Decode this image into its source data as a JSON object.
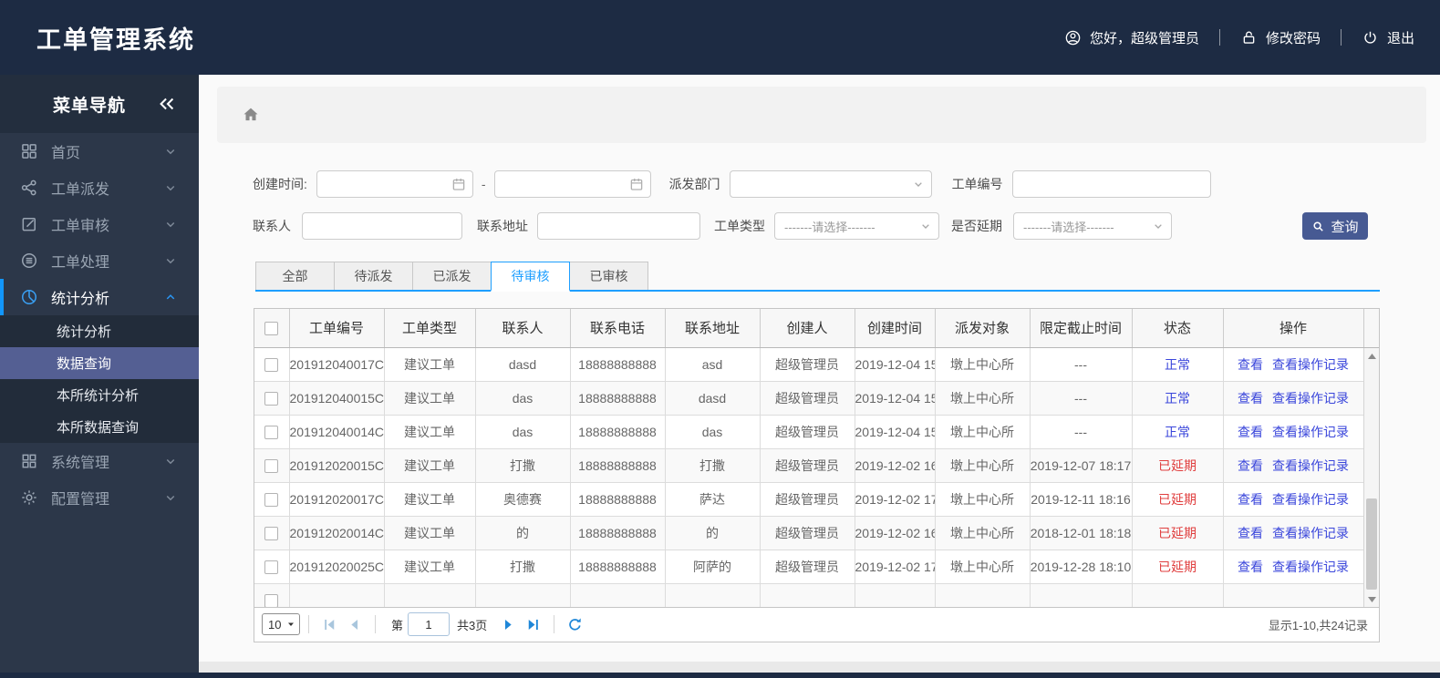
{
  "colors": {
    "header_bg": "#1d2b43",
    "sidebar_bg": "#2c3749",
    "sidebar_accent": "#1296fb",
    "submenu_selected": "#545f93",
    "tab_accent": "#1e9fff",
    "link_blue": "#3a46db",
    "status_normal_blue": "#3a46db",
    "status_overdue_red": "#e03e3e",
    "search_button": "#475a93"
  },
  "header": {
    "title": "工单管理系统",
    "greeting": "您好，超级管理员",
    "change_password": "修改密码",
    "logout": "退出"
  },
  "sidebar": {
    "title": "菜单导航",
    "items": [
      {
        "key": "home",
        "icon": "grid-icon",
        "label": "首页"
      },
      {
        "key": "dispatch",
        "icon": "share-icon",
        "label": "工单派发"
      },
      {
        "key": "review",
        "icon": "edit-icon",
        "label": "工单审核"
      },
      {
        "key": "process",
        "icon": "process-icon",
        "label": "工单处理"
      },
      {
        "key": "stats",
        "icon": "pie-icon",
        "label": "统计分析",
        "active": true,
        "children": [
          {
            "key": "stats-analysis",
            "label": "统计分析"
          },
          {
            "key": "data-query",
            "label": "数据查询",
            "selected": true
          },
          {
            "key": "branch-stats",
            "label": "本所统计分析"
          },
          {
            "key": "branch-data-query",
            "label": "本所数据查询"
          }
        ]
      },
      {
        "key": "system",
        "icon": "modules-icon",
        "label": "系统管理"
      },
      {
        "key": "config",
        "icon": "gear-icon",
        "label": "配置管理"
      }
    ]
  },
  "filters": {
    "created_time_label": "创建时间:",
    "date_separator": "-",
    "dispatch_dept_label": "派发部门",
    "order_no_label": "工单编号",
    "contact_label": "联系人",
    "address_label": "联系地址",
    "order_type_label": "工单类型",
    "delay_label": "是否延期",
    "select_placeholder": "-------请选择-------",
    "search_button": "查询"
  },
  "tabs": [
    {
      "key": "all",
      "label": "全部"
    },
    {
      "key": "pending-dispatch",
      "label": "待派发"
    },
    {
      "key": "dispatched",
      "label": "已派发"
    },
    {
      "key": "pending-review",
      "label": "待审核",
      "active": true
    },
    {
      "key": "reviewed",
      "label": "已审核"
    }
  ],
  "table": {
    "columns": [
      "工单编号",
      "工单类型",
      "联系人",
      "联系电话",
      "联系地址",
      "创建人",
      "创建时间",
      "派发对象",
      "限定截止时间",
      "状态",
      "操作"
    ],
    "action_labels": [
      "查看",
      "查看操作记录"
    ],
    "rows": [
      {
        "cells": [
          "201912040017C",
          "建议工单",
          "dasd",
          "18888888888",
          "asd",
          "超级管理员",
          "2019-12-04 15",
          "墩上中心所",
          "---"
        ],
        "status": "正常",
        "status_type": "normal"
      },
      {
        "cells": [
          "201912040015C",
          "建议工单",
          "das",
          "18888888888",
          "dasd",
          "超级管理员",
          "2019-12-04 15",
          "墩上中心所",
          "---"
        ],
        "status": "正常",
        "status_type": "normal"
      },
      {
        "cells": [
          "201912040014C",
          "建议工单",
          "das",
          "18888888888",
          "das",
          "超级管理员",
          "2019-12-04 15",
          "墩上中心所",
          "---"
        ],
        "status": "正常",
        "status_type": "normal"
      },
      {
        "cells": [
          "201912020015C",
          "建议工单",
          "打撒",
          "18888888888",
          "打撒",
          "超级管理员",
          "2019-12-02 16",
          "墩上中心所",
          "2019-12-07 18:17"
        ],
        "status": "已延期",
        "status_type": "delayed"
      },
      {
        "cells": [
          "201912020017C",
          "建议工单",
          "奥德赛",
          "18888888888",
          "萨达",
          "超级管理员",
          "2019-12-02 17",
          "墩上中心所",
          "2019-12-11 18:16"
        ],
        "status": "已延期",
        "status_type": "delayed"
      },
      {
        "cells": [
          "201912020014C",
          "建议工单",
          "的",
          "18888888888",
          "的",
          "超级管理员",
          "2019-12-02 16",
          "墩上中心所",
          "2018-12-01 18:18"
        ],
        "status": "已延期",
        "status_type": "delayed"
      },
      {
        "cells": [
          "201912020025C",
          "建议工单",
          "打撒",
          "18888888888",
          "阿萨的",
          "超级管理员",
          "2019-12-02 17",
          "墩上中心所",
          "2019-12-28 18:10"
        ],
        "status": "已延期",
        "status_type": "delayed"
      },
      {
        "cells": [
          "",
          "",
          "",
          "",
          "",
          "",
          "",
          "",
          ""
        ],
        "status": "",
        "status_type": "none",
        "partial": true
      }
    ]
  },
  "pagination": {
    "page_size": "10",
    "page_prefix": "第",
    "current_page": "1",
    "total_pages": "共3页",
    "summary": "显示1-10,共24记录"
  }
}
